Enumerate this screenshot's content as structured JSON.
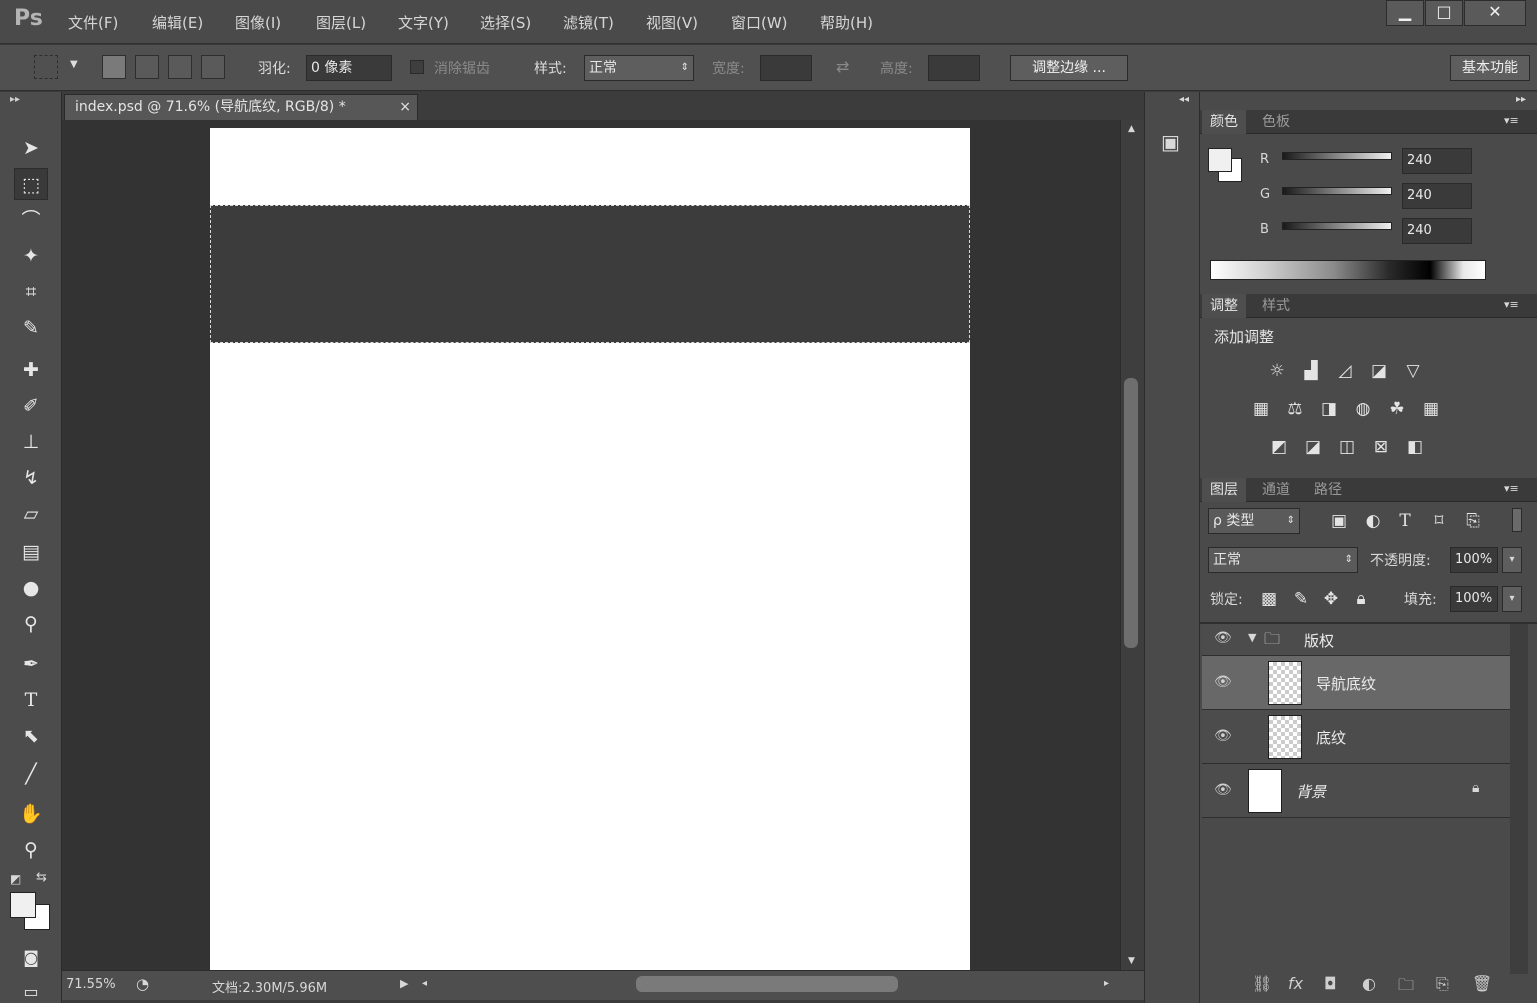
{
  "app": {
    "logo": "Ps"
  },
  "menu": [
    "文件(F)",
    "编辑(E)",
    "图像(I)",
    "图层(L)",
    "文字(Y)",
    "选择(S)",
    "滤镜(T)",
    "视图(V)",
    "窗口(W)",
    "帮助(H)"
  ],
  "window": {
    "minimize": "▁",
    "maximize": "□",
    "close": "✕"
  },
  "options": {
    "feather_label": "羽化:",
    "feather_value": "0 像素",
    "antialias_label": "消除锯齿",
    "style_label": "样式:",
    "style_value": "正常",
    "width_label": "宽度:",
    "height_label": "高度:",
    "refine_edge": "调整边缘 ...",
    "workspace": "基本功能"
  },
  "document": {
    "tab_title": "index.psd @ 71.6% (导航底纹, RGB/8) *",
    "tab_close": "×",
    "zoom": "71.55%",
    "doc_info": "文档:2.30M/5.96M"
  },
  "color_panel": {
    "tabs": [
      "颜色",
      "色板"
    ],
    "channels": [
      {
        "label": "R",
        "value": "240"
      },
      {
        "label": "G",
        "value": "240"
      },
      {
        "label": "B",
        "value": "240"
      }
    ]
  },
  "adjust_panel": {
    "tabs": [
      "调整",
      "样式"
    ],
    "title": "添加调整"
  },
  "layers_panel": {
    "tabs": [
      "图层",
      "通道",
      "路径"
    ],
    "filter_label": "ρ 类型",
    "blend_mode": "正常",
    "opacity_label": "不透明度:",
    "opacity_value": "100%",
    "lock_label": "锁定:",
    "fill_label": "填充:",
    "fill_value": "100%",
    "layers": [
      {
        "name": "版权",
        "type": "group"
      },
      {
        "name": "导航底纹",
        "type": "layer",
        "selected": true
      },
      {
        "name": "底纹",
        "type": "layer"
      },
      {
        "name": "背景",
        "type": "background",
        "locked": true
      }
    ]
  },
  "colors": {
    "foreground": "#f0f0f0",
    "background": "#ffffff",
    "nav_band": "#3c3c3c"
  }
}
